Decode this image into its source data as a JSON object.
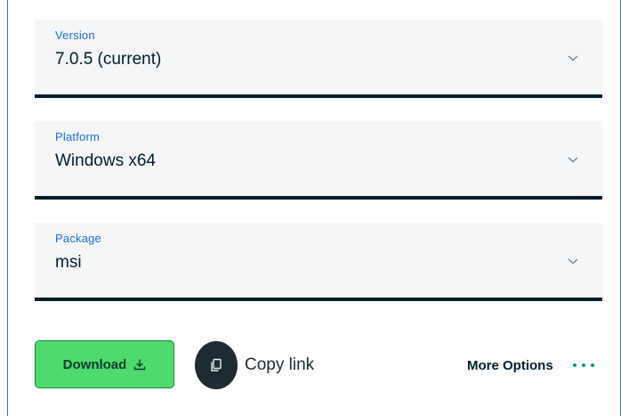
{
  "fields": [
    {
      "label": "Version",
      "value": "7.0.5 (current)"
    },
    {
      "label": "Platform",
      "value": "Windows x64"
    },
    {
      "label": "Package",
      "value": "msi"
    }
  ],
  "actions": {
    "download_label": "Download",
    "copy_link_label": "Copy link",
    "more_options_label": "More Options"
  },
  "icons": {
    "chevron": "chevron-down-icon",
    "download": "download-icon",
    "copy": "copy-icon",
    "more": "ellipsis-icon"
  },
  "colors": {
    "label": "#1a6de0",
    "field_bg": "#f5f6f7",
    "underline": "#001e2b",
    "download_bg": "#4fda6e",
    "dots": "#00a35c"
  }
}
